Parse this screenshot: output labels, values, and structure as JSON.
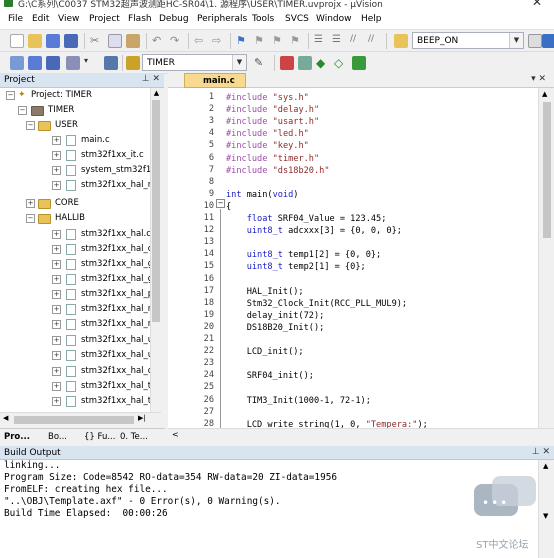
{
  "window": {
    "title": "G:\\C系列\\C0037 STM32超声波测距HC-SR04\\1. 源程序\\USER\\TIMER.uvprojx - µVision"
  },
  "menu": [
    "File",
    "Edit",
    "View",
    "Project",
    "Flash",
    "Debug",
    "Peripherals",
    "Tools",
    "SVCS",
    "Window",
    "Help"
  ],
  "toolbar": {
    "find_combo": "BEEP_ON",
    "target_combo": "TIMER"
  },
  "project_pane": {
    "header": "Project",
    "root": "Project: TIMER",
    "target": "TIMER",
    "groups": [
      {
        "name": "USER",
        "files": [
          "main.c",
          "stm32f1xx_it.c",
          "system_stm32f1x",
          "stm32f1xx_hal_m"
        ]
      },
      {
        "name": "CORE",
        "files": []
      },
      {
        "name": "HALLIB",
        "files": [
          "stm32f1xx_hal.c",
          "stm32f1xx_hal_c",
          "stm32f1xx_hal_g",
          "stm32f1xx_hal_g",
          "stm32f1xx_hal_p",
          "stm32f1xx_hal_r",
          "stm32f1xx_hal_r",
          "stm32f1xx_hal_u",
          "stm32f1xx_hal_u",
          "stm32f1xx_hal_d",
          "stm32f1xx_hal_ti",
          "stm32f1xx_hal_ti"
        ]
      }
    ],
    "bottom_tabs": [
      "Pro...",
      "Bo...",
      "{} Fu...",
      "0. Te..."
    ]
  },
  "editor": {
    "tab": "main.c",
    "lines": [
      {
        "n": "1",
        "c": "#include \"sys.h\""
      },
      {
        "n": "2",
        "c": "#include \"delay.h\""
      },
      {
        "n": "3",
        "c": "#include \"usart.h\""
      },
      {
        "n": "4",
        "c": "#include \"led.h\""
      },
      {
        "n": "5",
        "c": "#include \"key.h\""
      },
      {
        "n": "6",
        "c": "#include \"timer.h\""
      },
      {
        "n": "7",
        "c": "#include \"ds18b20.h\""
      },
      {
        "n": "8",
        "c": ""
      },
      {
        "n": "9",
        "c": "int main(void)"
      },
      {
        "n": "10",
        "c": "{"
      },
      {
        "n": "11",
        "c": "    float SRF04_Value = 123.45;"
      },
      {
        "n": "12",
        "c": "    uint8_t adcxxx[3] = {0, 0, 0};"
      },
      {
        "n": "13",
        "c": ""
      },
      {
        "n": "14",
        "c": "    uint8_t temp1[2] = {0, 0};"
      },
      {
        "n": "15",
        "c": "    uint8_t temp2[1] = {0};"
      },
      {
        "n": "16",
        "c": ""
      },
      {
        "n": "17",
        "c": "    HAL_Init();"
      },
      {
        "n": "18",
        "c": "    Stm32_Clock_Init(RCC_PLL_MUL9);"
      },
      {
        "n": "19",
        "c": "    delay_init(72);"
      },
      {
        "n": "20",
        "c": "    DS18B20_Init();"
      },
      {
        "n": "21",
        "c": ""
      },
      {
        "n": "22",
        "c": "    LCD_init();"
      },
      {
        "n": "23",
        "c": ""
      },
      {
        "n": "24",
        "c": "    SRF04_init();"
      },
      {
        "n": "25",
        "c": ""
      },
      {
        "n": "26",
        "c": "    TIM3_Init(1000-1, 72-1);"
      },
      {
        "n": "27",
        "c": ""
      },
      {
        "n": "28",
        "c": "    LCD_write_string(1, 0, \"Tempera:\");"
      }
    ]
  },
  "build": {
    "header": "Build Output",
    "lines": [
      "linking...",
      "Program Size: Code=8542 RO-data=354 RW-data=20 ZI-data=1956",
      "FromELF: creating hex file...",
      "\"..\\OBJ\\Template.axf\" - 0 Error(s), 0 Warning(s).",
      "Build Time Elapsed:  00:00:26"
    ]
  },
  "watermark": "ST中文论坛"
}
